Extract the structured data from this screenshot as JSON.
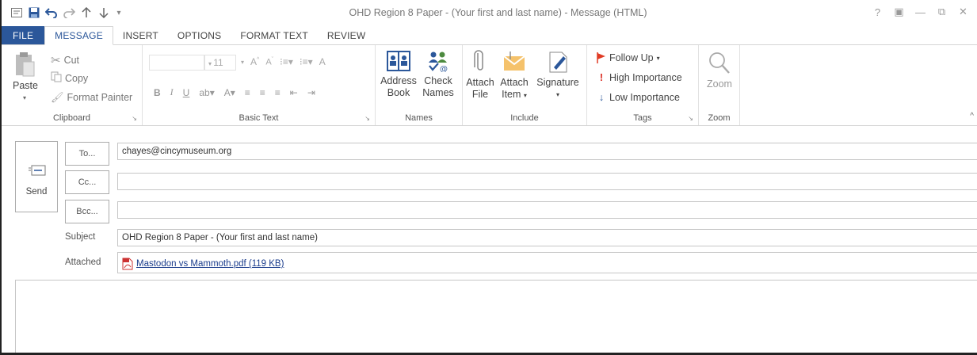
{
  "window": {
    "title": "OHD Region 8 Paper - (Your first and last name) - Message (HTML)",
    "controls": [
      "?",
      "▣",
      "—",
      "⧉",
      "✕"
    ]
  },
  "tabs": [
    "FILE",
    "MESSAGE",
    "INSERT",
    "OPTIONS",
    "FORMAT TEXT",
    "REVIEW"
  ],
  "active_tab": "MESSAGE",
  "ribbon": {
    "clipboard": {
      "paste": "Paste",
      "cut": "Cut",
      "copy": "Copy",
      "format_painter": "Format Painter",
      "label": "Clipboard"
    },
    "basic_text": {
      "font_size": "11",
      "label": "Basic Text"
    },
    "names": {
      "address_book_line1": "Address",
      "address_book_line2": "Book",
      "check_names_line1": "Check",
      "check_names_line2": "Names",
      "label": "Names"
    },
    "include": {
      "attach_file_line1": "Attach",
      "attach_file_line2": "File",
      "attach_item_line1": "Attach",
      "attach_item_line2": "Item",
      "signature": "Signature",
      "label": "Include"
    },
    "tags": {
      "follow_up": "Follow Up",
      "high_importance": "High Importance",
      "low_importance": "Low Importance",
      "label": "Tags"
    },
    "zoom": {
      "zoom_btn": "Zoom",
      "label": "Zoom"
    }
  },
  "compose": {
    "send": "Send",
    "to_btn": "To...",
    "cc_btn": "Cc...",
    "bcc_btn": "Bcc...",
    "to_value": "chayes@cincymuseum.org",
    "cc_value": "",
    "bcc_value": "",
    "subject_label": "Subject",
    "subject_value": "OHD Region 8 Paper - (Your first and last name)",
    "attached_label": "Attached",
    "attachment": "Mastodon vs Mammoth.pdf (119 KB)"
  },
  "colors": {
    "accent": "#2b579a",
    "flag_red": "#e03b24",
    "importance_red": "#d9261c",
    "low_blue": "#2b579a"
  }
}
